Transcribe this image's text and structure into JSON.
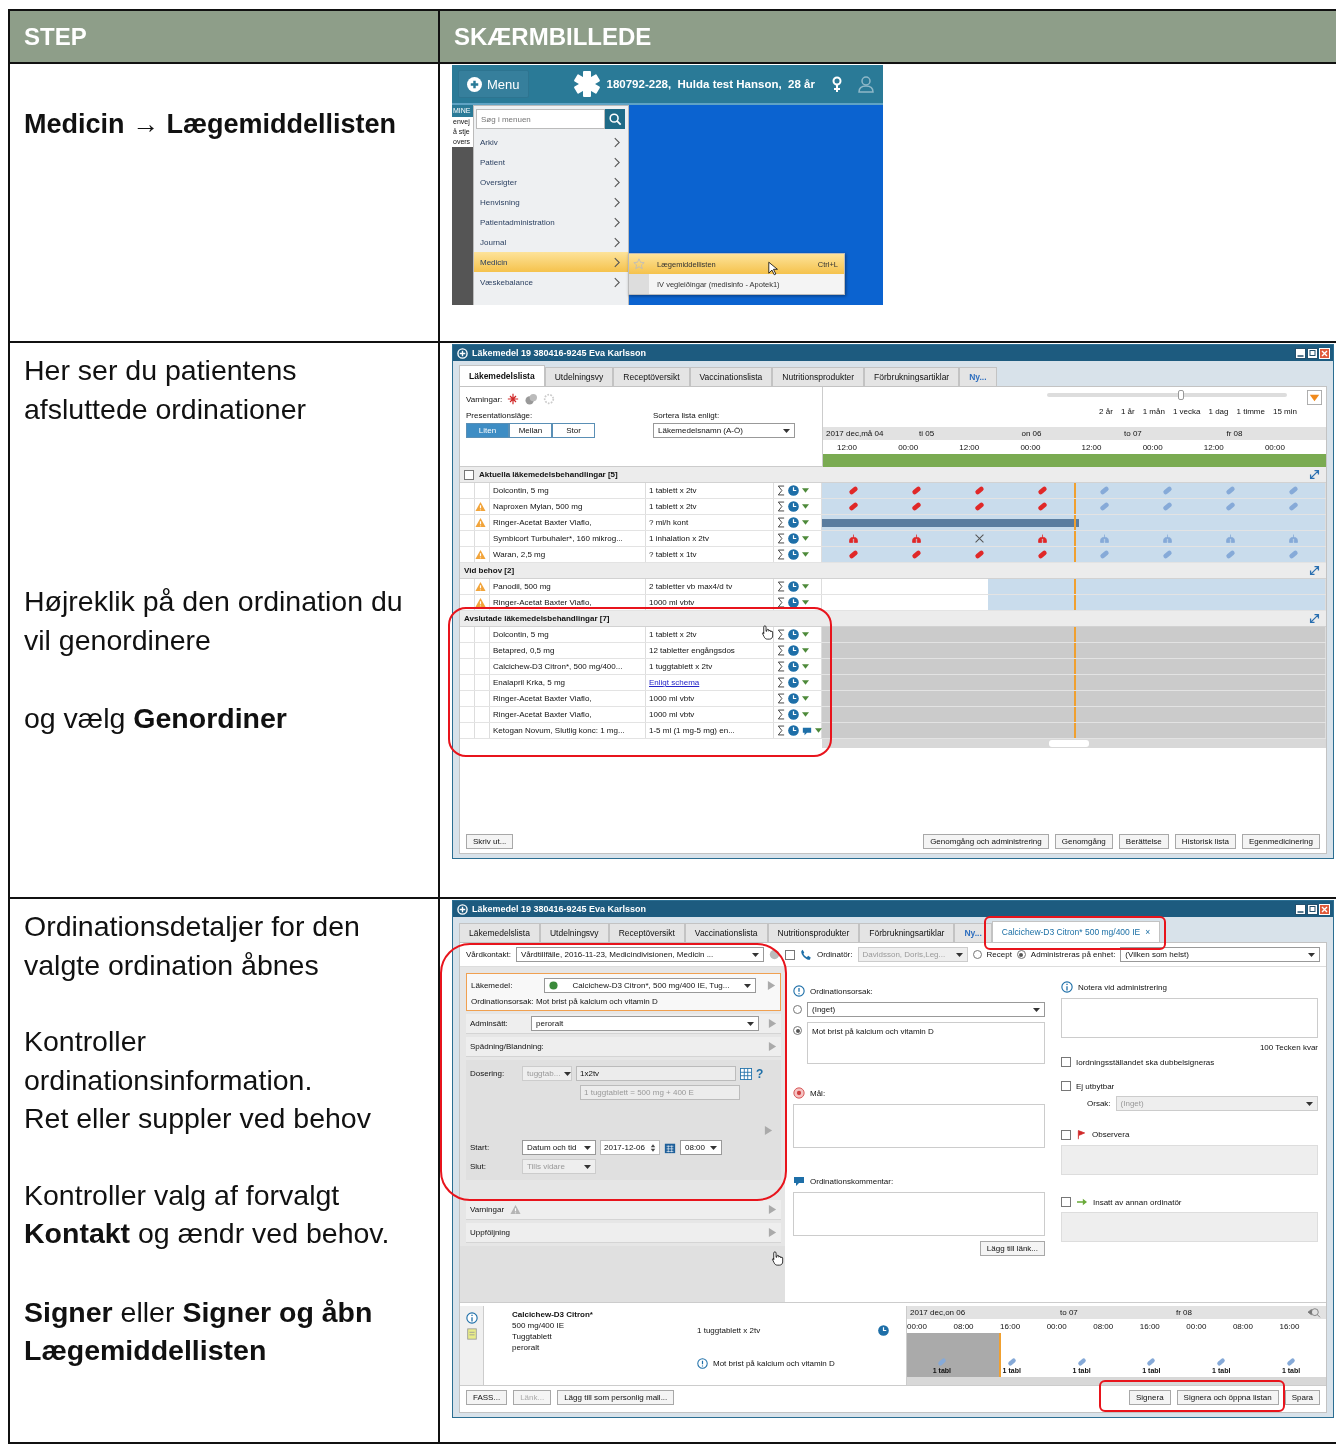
{
  "table": {
    "columns": [
      "STEP",
      "SKÆRMBILLEDE"
    ]
  },
  "rows": [
    {
      "instructions": [
        {
          "text": "Medicin → Lægemiddellisten",
          "bold": true
        }
      ],
      "screenshot": {
        "kind": "menu",
        "menu_button": "Menu",
        "patient": "180792-228,  Hulda test Hanson,  28 år",
        "side_texts": [
          "MINE",
          "envej",
          "å stje",
          "overs"
        ],
        "search": {
          "placeholder": "Søg i menuen"
        },
        "items": [
          {
            "label": "Arkiv",
            "selected": false
          },
          {
            "label": "Patient",
            "selected": false
          },
          {
            "label": "Oversigter",
            "selected": false
          },
          {
            "label": "Henvisning",
            "selected": false
          },
          {
            "label": "Patientadministration",
            "selected": false
          },
          {
            "label": "Journal",
            "selected": false
          },
          {
            "label": "Medicin",
            "selected": true
          },
          {
            "label": "Væskebalance",
            "selected": false
          }
        ],
        "submenu": [
          {
            "label": "Lægemiddellisten",
            "shortcut": "Ctrl+L",
            "selected": true
          },
          {
            "label": "IV vegleiðingar (medisinfo - Apotek1)",
            "selected": false
          }
        ]
      }
    },
    {
      "instructions": [
        {
          "text": "Her ser du patientens afsluttede ordinationer",
          "bold": false
        },
        {
          "text": "Højreklik på den ordination du vil genordinere",
          "bold": false
        },
        {
          "text": "og vælg **Genordiner**",
          "bold": false
        }
      ],
      "screenshot": {
        "kind": "list",
        "title": "Läkemedel 19 380416-9245 Eva Karlsson",
        "tabs": [
          {
            "label": "Läkemedelslista",
            "selected": true,
            "kind": "tab"
          },
          {
            "label": "Utdelningsvy",
            "selected": false,
            "kind": "tab"
          },
          {
            "label": "Receptöversikt",
            "selected": false,
            "kind": "tab"
          },
          {
            "label": "Vaccinationslista",
            "selected": false,
            "kind": "tab"
          },
          {
            "label": "Nutritionsprodukter",
            "selected": false,
            "kind": "tab"
          },
          {
            "label": "Förbrukningsartiklar",
            "selected": false,
            "kind": "tab"
          },
          {
            "label": "Ny...",
            "selected": false,
            "kind": "link"
          }
        ],
        "warnings_label": "Varningar:",
        "presentation": {
          "label": "Presentationsläge:",
          "options": [
            {
              "label": "Liten",
              "selected": true
            },
            {
              "label": "Mellan",
              "selected": false
            },
            {
              "label": "Stor",
              "selected": false
            }
          ]
        },
        "sort": {
          "label": "Sortera lista enligt:",
          "value": "Läkemedelsnamn (A-Ö)"
        },
        "zoom": {
          "level": 0.56,
          "labels": [
            "2 år",
            "1 år",
            "1 mån",
            "1 vecka",
            "1 dag",
            "1 timme",
            "15 min"
          ]
        },
        "days": [
          "2017 dec,må 04",
          "ti 05",
          "on 06",
          "to 07",
          "fr 08"
        ],
        "hours": [
          "12:00",
          "00:00",
          "12:00",
          "00:00",
          "12:00",
          "00:00",
          "12:00",
          "00:00"
        ],
        "groups": [
          {
            "title": "Aktuella läkemedelsbehandlingar [5]",
            "kind": "checkable",
            "checked": false,
            "rows": [
              {
                "name": "Dolcontin, 5 mg",
                "dose": "1 tablett x 2tv",
                "warning": false,
                "link": false,
                "comment": false,
                "kind": "tablet"
              },
              {
                "name": "Naproxen Mylan, 500 mg",
                "dose": "1 tablett x 2tv",
                "warning": true,
                "link": false,
                "comment": false,
                "kind": "tablet"
              },
              {
                "name": "Ringer-Acetat Baxter Viaflo,",
                "dose": "?  ml/h kont",
                "warning": true,
                "link": false,
                "comment": false,
                "kind": "infusion"
              },
              {
                "name": "Symbicort Turbuhaler*, 160 mikrog...",
                "dose": "1 inhalation x 2tv",
                "warning": false,
                "link": false,
                "comment": false,
                "kind": "inhaler"
              },
              {
                "name": "Waran, 2,5 mg",
                "dose": "? tablett  x 1tv",
                "warning": true,
                "link": false,
                "comment": false,
                "kind": "tablet"
              }
            ]
          },
          {
            "title": "Vid behov [2]",
            "kind": "plain",
            "rows": [
              {
                "name": "Panodil, 500 mg",
                "dose": "2 tabletter  vb max4/d tv",
                "warning": true,
                "link": false,
                "comment": false,
                "kind": "prn"
              },
              {
                "name": "Ringer-Acetat Baxter Viaflo,",
                "dose": "1000 ml  vbtv",
                "warning": true,
                "link": false,
                "comment": false,
                "kind": "prn"
              }
            ]
          },
          {
            "title": "Avslutade läkemedelsbehandlingar [7]",
            "kind": "plain",
            "rows": [
              {
                "name": "Dolcontin, 5 mg",
                "dose": "1 tablett x 2tv",
                "warning": false,
                "link": false,
                "comment": false,
                "kind": "ended"
              },
              {
                "name": "Betapred, 0,5 mg",
                "dose": "12 tabletter  engångsdos",
                "warning": false,
                "link": false,
                "comment": false,
                "kind": "ended"
              },
              {
                "name": "Calcichew-D3 Citron*, 500 mg/400...",
                "dose": "1 tuggtablett x 2tv",
                "warning": false,
                "link": false,
                "comment": false,
                "kind": "ended"
              },
              {
                "name": "Enalapril Krka, 5 mg",
                "dose": "Enligt schema",
                "warning": false,
                "link": true,
                "comment": false,
                "kind": "ended"
              },
              {
                "name": "Ringer-Acetat Baxter Viaflo,",
                "dose": "1000 ml  vbtv",
                "warning": false,
                "link": false,
                "comment": false,
                "kind": "ended"
              },
              {
                "name": "Ringer-Acetat Baxter Viaflo,",
                "dose": "1000 ml  vbtv",
                "warning": false,
                "link": false,
                "comment": false,
                "kind": "ended"
              },
              {
                "name": "Ketogan Novum, Slutlig konc: 1 mg...",
                "dose": "1-5 ml   (1 mg-5 mg) en...",
                "warning": false,
                "link": false,
                "comment": true,
                "kind": "ended"
              }
            ]
          }
        ],
        "left_buttons": [
          "Skriv ut..."
        ],
        "right_buttons": [
          "Genomgång och administrering",
          "Genomgång",
          "Berättelse",
          "Historisk lista",
          "Egenmedicinering"
        ]
      }
    },
    {
      "instructions": [
        {
          "text": "Ordinationsdetaljer for den valgte ordination åbnes",
          "bold": false
        },
        {
          "text": "Kontroller ordinationsinformation.",
          "bold": false
        },
        {
          "text": "Ret eller suppler ved behov",
          "bold": false
        },
        {
          "text": "Kontroller valg af forvalgt **Kontakt** og ændr ved behov.",
          "bold": false
        },
        {
          "text": "**Signer** eller **Signer og åbn Lægemiddellisten**",
          "bold": false
        }
      ],
      "screenshot": {
        "kind": "order",
        "title": "Läkemedel 19 380416-9245 Eva Karlsson",
        "tabs": [
          {
            "label": "Läkemedelslista",
            "selected": false,
            "kind": "tab"
          },
          {
            "label": "Utdelningsvy",
            "selected": false,
            "kind": "tab"
          },
          {
            "label": "Receptöversikt",
            "selected": false,
            "kind": "tab"
          },
          {
            "label": "Vaccinationslista",
            "selected": false,
            "kind": "tab"
          },
          {
            "label": "Nutritionsprodukter",
            "selected": false,
            "kind": "tab"
          },
          {
            "label": "Förbrukningsartiklar",
            "selected": false,
            "kind": "tab"
          },
          {
            "label": "Ny...",
            "selected": false,
            "kind": "link"
          },
          {
            "label": "Calcichew-D3 Citron* 500 mg/400 IE",
            "selected": true,
            "kind": "closable",
            "close": "×"
          }
        ],
        "contact": {
          "label": "Vårdkontakt:",
          "value": "Vårdtillfälle, 2016-11-23, Medicindivisionen, Medicin ..."
        },
        "phone_order": {
          "checked": false
        },
        "prescriber": {
          "label": "Ordinatör:",
          "value": "Davidsson, Doris,Leg..."
        },
        "recept": {
          "label": "Recept",
          "selected": false
        },
        "unit": {
          "label": "Administreras på enhet:",
          "selected": true,
          "value": "(Vilken som helst)"
        },
        "left": {
          "drug_label": "Läkemedel:",
          "drug": "Calcichew-D3 Citron*, 500 mg/400 IE, Tug...",
          "reason": "Ordinationsorsak: Mot brist på kalcium och vitamin D",
          "route_label": "Adminsätt:",
          "route": "peroralt",
          "dilution": "Spädning/Blandning:",
          "dose_label": "Dosering:",
          "dose_form": "tuggtab...",
          "dose": "1x2tv",
          "dose_note": "1 tuggtablett = 500 mg + 400 E",
          "dose_help": "?",
          "start_label": "Start:",
          "start_kind": "Datum och tid",
          "start_date": "2017-12-06",
          "start_time": "08:00",
          "end_label": "Slut:",
          "end_value": "Tills vidare",
          "sections": [
            {
              "label": "Varningar",
              "kind": "warning"
            },
            {
              "label": "Uppföljning",
              "kind": "plain"
            }
          ]
        },
        "middle": {
          "reason_label": "Ordinationsorsak:",
          "reason_options": [
            {
              "label": "(Inget)",
              "selected": false
            },
            {
              "label": "Mot brist på kalcium och vitamin D",
              "selected": true
            }
          ],
          "goal_label": "Mål:",
          "comment_label": "Ordinationskommentar:",
          "link_button": "Lägg till länk..."
        },
        "right": {
          "note_label": "Notera vid administrering",
          "counter": "100 Tecken kvar",
          "double_sign": {
            "label": "Iordningsställandet ska dubbelsigneras",
            "checked": false
          },
          "not_exchangeable": {
            "label": "Ej utbytbar",
            "checked": false
          },
          "cause": {
            "label": "Orsak:",
            "value": "(Inget)"
          },
          "observe": {
            "label": "Observera",
            "checked": false
          },
          "other_prescriber": {
            "label": "Insatt av annan ordinatör",
            "checked": false
          }
        },
        "summary": {
          "name": "Calcichew-D3 Citron*",
          "details": [
            "500 mg/400 IE",
            "Tuggtablett",
            "peroralt"
          ],
          "dose": "1 tuggtablett x 2tv",
          "reason": "Mot brist på kalcium och vitamin D",
          "days": [
            "2017 dec,on 06",
            "to 07",
            "fr 08"
          ],
          "hours": [
            "00:00",
            "08:00",
            "16:00",
            "00:00",
            "08:00",
            "16:00",
            "00:00",
            "08:00",
            "16:00"
          ],
          "doses": [
            "1 tabl",
            "1 tabl",
            "1 tabl",
            "1 tabl",
            "1 tabl",
            "1 tabl"
          ]
        },
        "left_buttons": [
          {
            "label": "FASS...",
            "disabled": false
          },
          {
            "label": "Länk...",
            "disabled": true
          },
          {
            "label": "Lägg till som personlig mall...",
            "disabled": false
          }
        ],
        "right_buttons": [
          {
            "label": "Signera"
          },
          {
            "label": "Signera och öppna listan"
          },
          {
            "label": "Spara"
          }
        ]
      }
    }
  ]
}
